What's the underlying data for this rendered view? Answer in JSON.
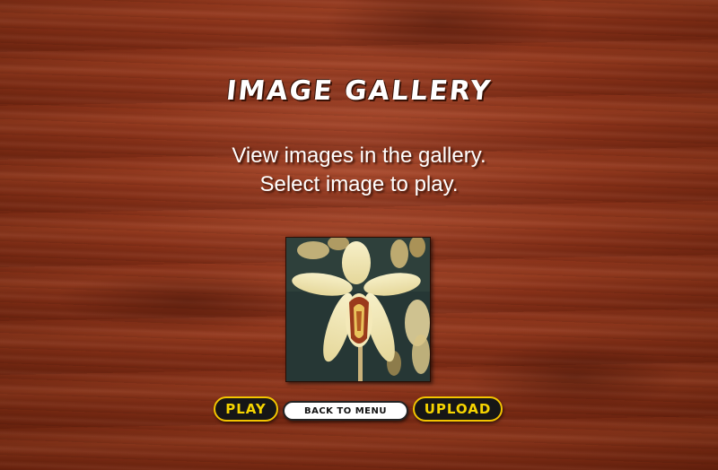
{
  "gallery": {
    "title": "IMAGE GALLERY",
    "line1": "View images in the gallery.",
    "line2": "Select image to play."
  },
  "thumbnail": {
    "subject": "orchid"
  },
  "buttons": {
    "play": "PLAY",
    "menu": "BACK TO MENU",
    "upload": "UPLOAD"
  },
  "colors": {
    "wood": "#8a3219",
    "button_fill": "#161616",
    "button_text": "#f6d400",
    "menu_button_fill": "#ffffff"
  }
}
